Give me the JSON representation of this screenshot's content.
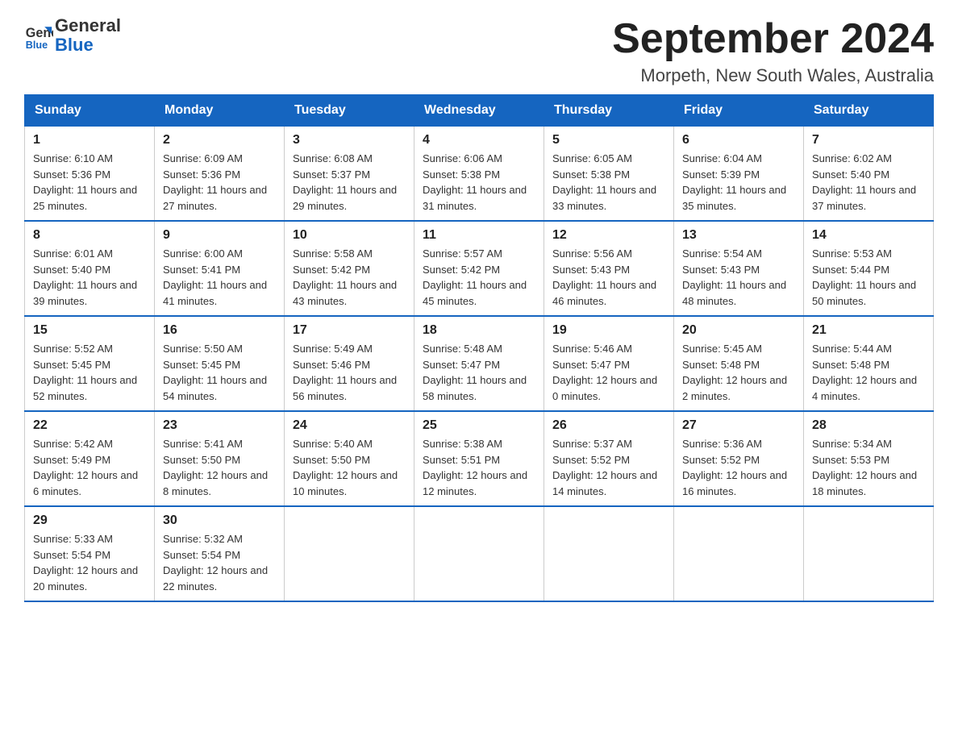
{
  "header": {
    "logo_text_general": "General",
    "logo_text_blue": "Blue",
    "month_title": "September 2024",
    "location": "Morpeth, New South Wales, Australia"
  },
  "days_of_week": [
    "Sunday",
    "Monday",
    "Tuesday",
    "Wednesday",
    "Thursday",
    "Friday",
    "Saturday"
  ],
  "weeks": [
    [
      {
        "day": "1",
        "sunrise": "6:10 AM",
        "sunset": "5:36 PM",
        "daylight": "11 hours and 25 minutes."
      },
      {
        "day": "2",
        "sunrise": "6:09 AM",
        "sunset": "5:36 PM",
        "daylight": "11 hours and 27 minutes."
      },
      {
        "day": "3",
        "sunrise": "6:08 AM",
        "sunset": "5:37 PM",
        "daylight": "11 hours and 29 minutes."
      },
      {
        "day": "4",
        "sunrise": "6:06 AM",
        "sunset": "5:38 PM",
        "daylight": "11 hours and 31 minutes."
      },
      {
        "day": "5",
        "sunrise": "6:05 AM",
        "sunset": "5:38 PM",
        "daylight": "11 hours and 33 minutes."
      },
      {
        "day": "6",
        "sunrise": "6:04 AM",
        "sunset": "5:39 PM",
        "daylight": "11 hours and 35 minutes."
      },
      {
        "day": "7",
        "sunrise": "6:02 AM",
        "sunset": "5:40 PM",
        "daylight": "11 hours and 37 minutes."
      }
    ],
    [
      {
        "day": "8",
        "sunrise": "6:01 AM",
        "sunset": "5:40 PM",
        "daylight": "11 hours and 39 minutes."
      },
      {
        "day": "9",
        "sunrise": "6:00 AM",
        "sunset": "5:41 PM",
        "daylight": "11 hours and 41 minutes."
      },
      {
        "day": "10",
        "sunrise": "5:58 AM",
        "sunset": "5:42 PM",
        "daylight": "11 hours and 43 minutes."
      },
      {
        "day": "11",
        "sunrise": "5:57 AM",
        "sunset": "5:42 PM",
        "daylight": "11 hours and 45 minutes."
      },
      {
        "day": "12",
        "sunrise": "5:56 AM",
        "sunset": "5:43 PM",
        "daylight": "11 hours and 46 minutes."
      },
      {
        "day": "13",
        "sunrise": "5:54 AM",
        "sunset": "5:43 PM",
        "daylight": "11 hours and 48 minutes."
      },
      {
        "day": "14",
        "sunrise": "5:53 AM",
        "sunset": "5:44 PM",
        "daylight": "11 hours and 50 minutes."
      }
    ],
    [
      {
        "day": "15",
        "sunrise": "5:52 AM",
        "sunset": "5:45 PM",
        "daylight": "11 hours and 52 minutes."
      },
      {
        "day": "16",
        "sunrise": "5:50 AM",
        "sunset": "5:45 PM",
        "daylight": "11 hours and 54 minutes."
      },
      {
        "day": "17",
        "sunrise": "5:49 AM",
        "sunset": "5:46 PM",
        "daylight": "11 hours and 56 minutes."
      },
      {
        "day": "18",
        "sunrise": "5:48 AM",
        "sunset": "5:47 PM",
        "daylight": "11 hours and 58 minutes."
      },
      {
        "day": "19",
        "sunrise": "5:46 AM",
        "sunset": "5:47 PM",
        "daylight": "12 hours and 0 minutes."
      },
      {
        "day": "20",
        "sunrise": "5:45 AM",
        "sunset": "5:48 PM",
        "daylight": "12 hours and 2 minutes."
      },
      {
        "day": "21",
        "sunrise": "5:44 AM",
        "sunset": "5:48 PM",
        "daylight": "12 hours and 4 minutes."
      }
    ],
    [
      {
        "day": "22",
        "sunrise": "5:42 AM",
        "sunset": "5:49 PM",
        "daylight": "12 hours and 6 minutes."
      },
      {
        "day": "23",
        "sunrise": "5:41 AM",
        "sunset": "5:50 PM",
        "daylight": "12 hours and 8 minutes."
      },
      {
        "day": "24",
        "sunrise": "5:40 AM",
        "sunset": "5:50 PM",
        "daylight": "12 hours and 10 minutes."
      },
      {
        "day": "25",
        "sunrise": "5:38 AM",
        "sunset": "5:51 PM",
        "daylight": "12 hours and 12 minutes."
      },
      {
        "day": "26",
        "sunrise": "5:37 AM",
        "sunset": "5:52 PM",
        "daylight": "12 hours and 14 minutes."
      },
      {
        "day": "27",
        "sunrise": "5:36 AM",
        "sunset": "5:52 PM",
        "daylight": "12 hours and 16 minutes."
      },
      {
        "day": "28",
        "sunrise": "5:34 AM",
        "sunset": "5:53 PM",
        "daylight": "12 hours and 18 minutes."
      }
    ],
    [
      {
        "day": "29",
        "sunrise": "5:33 AM",
        "sunset": "5:54 PM",
        "daylight": "12 hours and 20 minutes."
      },
      {
        "day": "30",
        "sunrise": "5:32 AM",
        "sunset": "5:54 PM",
        "daylight": "12 hours and 22 minutes."
      },
      null,
      null,
      null,
      null,
      null
    ]
  ],
  "labels": {
    "sunrise": "Sunrise:",
    "sunset": "Sunset:",
    "daylight": "Daylight:"
  }
}
